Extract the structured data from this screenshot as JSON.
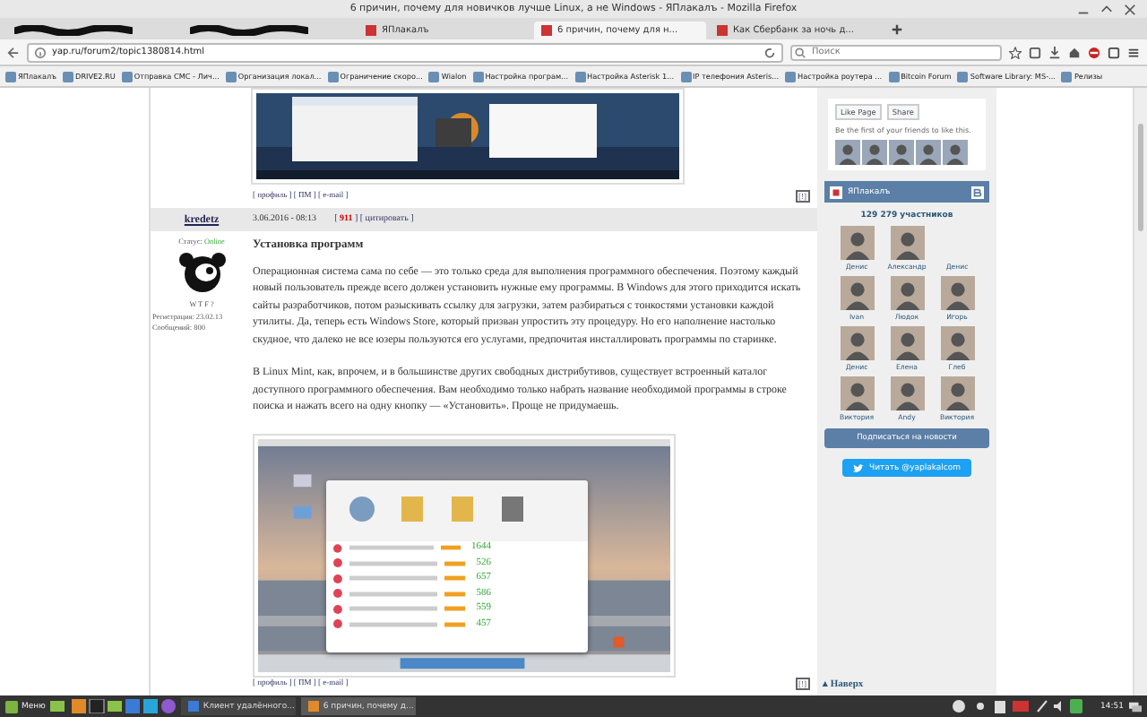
{
  "window": {
    "title": "6 причин, почему для новичков лучше Linux, а не Windows - ЯПлакалъ - Mozilla Firefox"
  },
  "tabs": [
    {
      "kind": "redacted",
      "selected": false
    },
    {
      "kind": "redacted",
      "selected": false
    },
    {
      "kind": "page",
      "label": "ЯПлакалъ",
      "selected": false
    },
    {
      "kind": "page",
      "label": "6 причин, почему для н...",
      "selected": true
    },
    {
      "kind": "page",
      "label": "Как Сбербанк за ночь д...",
      "selected": false
    }
  ],
  "address_bar": {
    "url": "yap.ru/forum2/topic1380814.html"
  },
  "search": {
    "placeholder": "Поиск"
  },
  "bookmarks": [
    "ЯПлакалъ",
    "DRIVE2.RU",
    "Отправка СМС - Лич...",
    "Организация локал...",
    "Ограничение скоро...",
    "Wialon",
    "Настройка програм...",
    "Настройка Asterisk 1...",
    "IP телефония Asteris...",
    "Настройка роутера ...",
    "Bitcoin Forum",
    "Software Library: MS-...",
    "Релизы"
  ],
  "previous_post": {
    "links": "[ профиль ] [ ПМ ] [ e-mail ]",
    "report": "[!]"
  },
  "post": {
    "author": "kredetz",
    "status_label": "Статус:",
    "status": "Online",
    "rank": "W T F ?",
    "registered": "Регистрация: 23.02.13",
    "messages": "Сообщений: 800",
    "date": "3.06.2016 - 08:13",
    "reply_links": "[ **911** ] [ цитировать ]",
    "title": "Установка программ",
    "paragraphs": [
      "Операционная система сама по себе — это только среда для выполнения программного обеспечения. Поэтому каждый новый пользователь прежде всего должен установить нужные ему программы. В Windows для этого приходится искать сайты разработчиков, потом разыскивать ссылку для загрузки, затем разбираться с тонкостями установки каждой утилиты. Да, теперь есть Windows Store, который призван упростить эту процедуру. Но его наполнение настолько скудное, что далеко не все юзеры пользуются его услугами, предпочитая инсталлировать программы по старинке.",
      "В Linux Mint, как, впрочем, и в большинстве других свободных дистрибутивов, существует встроенный каталог доступного программного обеспечения. Вам необходимо только набрать название необходимой программы в строке поиска и нажать всего на одну кнопку — «Установить». Проще не придумаешь."
    ],
    "screenshot_scores": [
      "1644",
      "526",
      "657",
      "586",
      "559",
      "457"
    ],
    "links": "[ профиль ] [ ПМ ] [ e-mail ]",
    "report": "[!]"
  },
  "facebook": {
    "like": "Like Page",
    "share": "Share",
    "note": "Be the first of your friends to like this."
  },
  "vk": {
    "name": "ЯПлакалъ",
    "count": "129 279 участников",
    "subscribe": "Подписаться на новости",
    "members": [
      {
        "name": "Денис",
        "avatar": true
      },
      {
        "name": "Александр",
        "avatar": true
      },
      {
        "name": "Денис",
        "avatar": false
      },
      {
        "name": "Ivan",
        "avatar": true
      },
      {
        "name": "Людок",
        "avatar": true
      },
      {
        "name": "Игорь",
        "avatar": true
      },
      {
        "name": "Денис",
        "avatar": true
      },
      {
        "name": "Елена",
        "avatar": true
      },
      {
        "name": "Глеб",
        "avatar": true
      },
      {
        "name": "Виктория",
        "avatar": true
      },
      {
        "name": "Andy",
        "avatar": true
      },
      {
        "name": "Виктория",
        "avatar": true
      }
    ]
  },
  "twitter": {
    "label": "Читать @yaplakalcom"
  },
  "to_top": "▴ Наверх",
  "taskbar": {
    "menu": "Меню",
    "windows": [
      {
        "label": "Клиент удалённого...",
        "selected": false
      },
      {
        "label": "6 причин, почему д...",
        "selected": true
      }
    ],
    "clock": "14:51"
  }
}
